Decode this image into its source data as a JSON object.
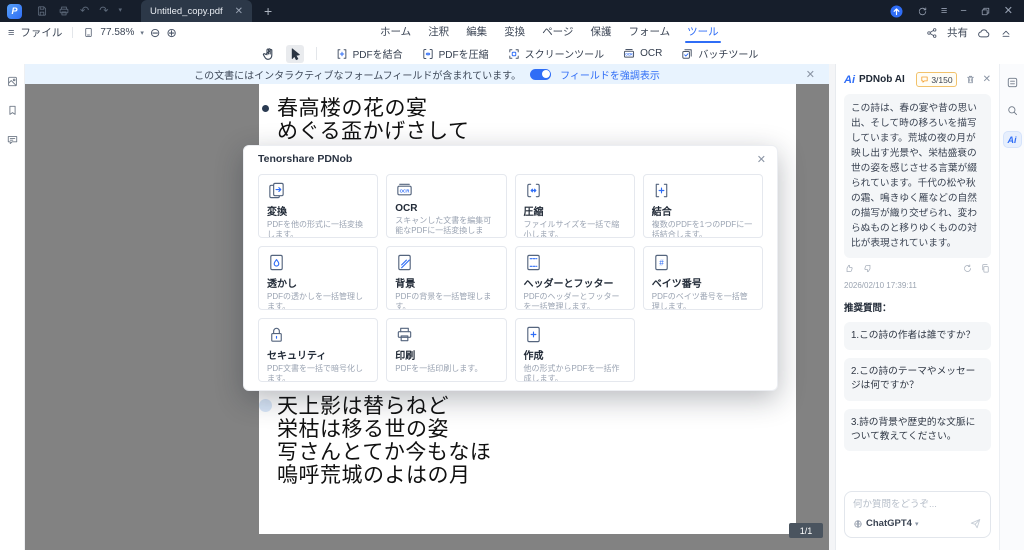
{
  "titlebar": {
    "logo_letter": "P",
    "tab_title": "Untitled_copy.pdf"
  },
  "menubar": {
    "file_label": "ファイル",
    "zoom_value": "77.58%",
    "tabs": [
      "ホーム",
      "注釈",
      "編集",
      "変換",
      "ページ",
      "保護",
      "フォーム",
      "ツール"
    ],
    "active_tab": "ツール",
    "share_label": "共有"
  },
  "toolbar": {
    "buttons": [
      {
        "icon": "merge-pdf-icon",
        "label": "PDFを結合"
      },
      {
        "icon": "compress-pdf-icon",
        "label": "PDFを圧縮"
      },
      {
        "icon": "screen-tool-icon",
        "label": "スクリーンツール"
      },
      {
        "icon": "ocr-tool-icon",
        "label": "OCR"
      },
      {
        "icon": "batch-tool-icon",
        "label": "バッチツール"
      }
    ]
  },
  "notification": {
    "text": "この文書にはインタラクティブなフォームフィールドが含まれています。",
    "toggle_label": "フィールドを強調表示"
  },
  "document": {
    "poem_top": [
      "春高楼の花の宴",
      "めぐる盃かげさして"
    ],
    "poem_bottom": [
      "天上影は替らねど",
      "栄枯は移る世の姿",
      "写さんとてか今もなほ",
      "嗚呼荒城のよはの月"
    ],
    "page_indicator": "1/1"
  },
  "modal": {
    "title": "Tenorshare PDNob",
    "tiles": [
      {
        "icon": "convert-tile-icon",
        "title": "変換",
        "desc": "PDFを他の形式に一括変換します。"
      },
      {
        "icon": "ocr-tile-icon",
        "title": "OCR",
        "desc": "スキャンした文書を編集可能なPDFに一括変換します。"
      },
      {
        "icon": "compress-tile-icon",
        "title": "圧縮",
        "desc": "ファイルサイズを一括で縮小します。"
      },
      {
        "icon": "merge-tile-icon",
        "title": "結合",
        "desc": "複数のPDFを1つのPDFに一括結合します。"
      },
      {
        "icon": "watermark-tile-icon",
        "title": "透かし",
        "desc": "PDFの透かしを一括管理します。"
      },
      {
        "icon": "background-tile-icon",
        "title": "背景",
        "desc": "PDFの背景を一括管理します。"
      },
      {
        "icon": "headerfooter-tile-icon",
        "title": "ヘッダーとフッター",
        "desc": "PDFのヘッダーとフッターを一括管理します。"
      },
      {
        "icon": "bates-tile-icon",
        "title": "ベイツ番号",
        "desc": "PDFのベイツ番号を一括管理します。"
      },
      {
        "icon": "security-tile-icon",
        "title": "セキュリティ",
        "desc": "PDF文書を一括で暗号化します。"
      },
      {
        "icon": "print-tile-icon",
        "title": "印刷",
        "desc": "PDFを一括印刷します。"
      },
      {
        "icon": "create-tile-icon",
        "title": "作成",
        "desc": "他の形式からPDFを一括作成します。"
      }
    ]
  },
  "ai_panel": {
    "logo_text": "Ai",
    "title": "PDNob AI",
    "quota": "3/150",
    "message": "この詩は、春の宴や昔の思い出、そして時の移ろいを描写しています。荒城の夜の月が映し出す光景や、栄枯盛衰の世の姿を感じさせる言葉が綴られています。千代の松や秋の霜、鳴きゆく雁などの自然の描写が織り交ぜられ、変わらぬものと移りゆくものの対比が表現されています。",
    "timestamp": "2026/02/10 17:39:11",
    "suggested_label": "推奨質問：",
    "questions": [
      "1.この詩の作者は誰ですか？",
      "2.この詩のテーマやメッセージは何ですか？",
      "3.詩の背景や歴史的な文脈について教えてください。"
    ],
    "input_placeholder": "何か質問をどうぞ...",
    "model": "ChatGPT4"
  }
}
